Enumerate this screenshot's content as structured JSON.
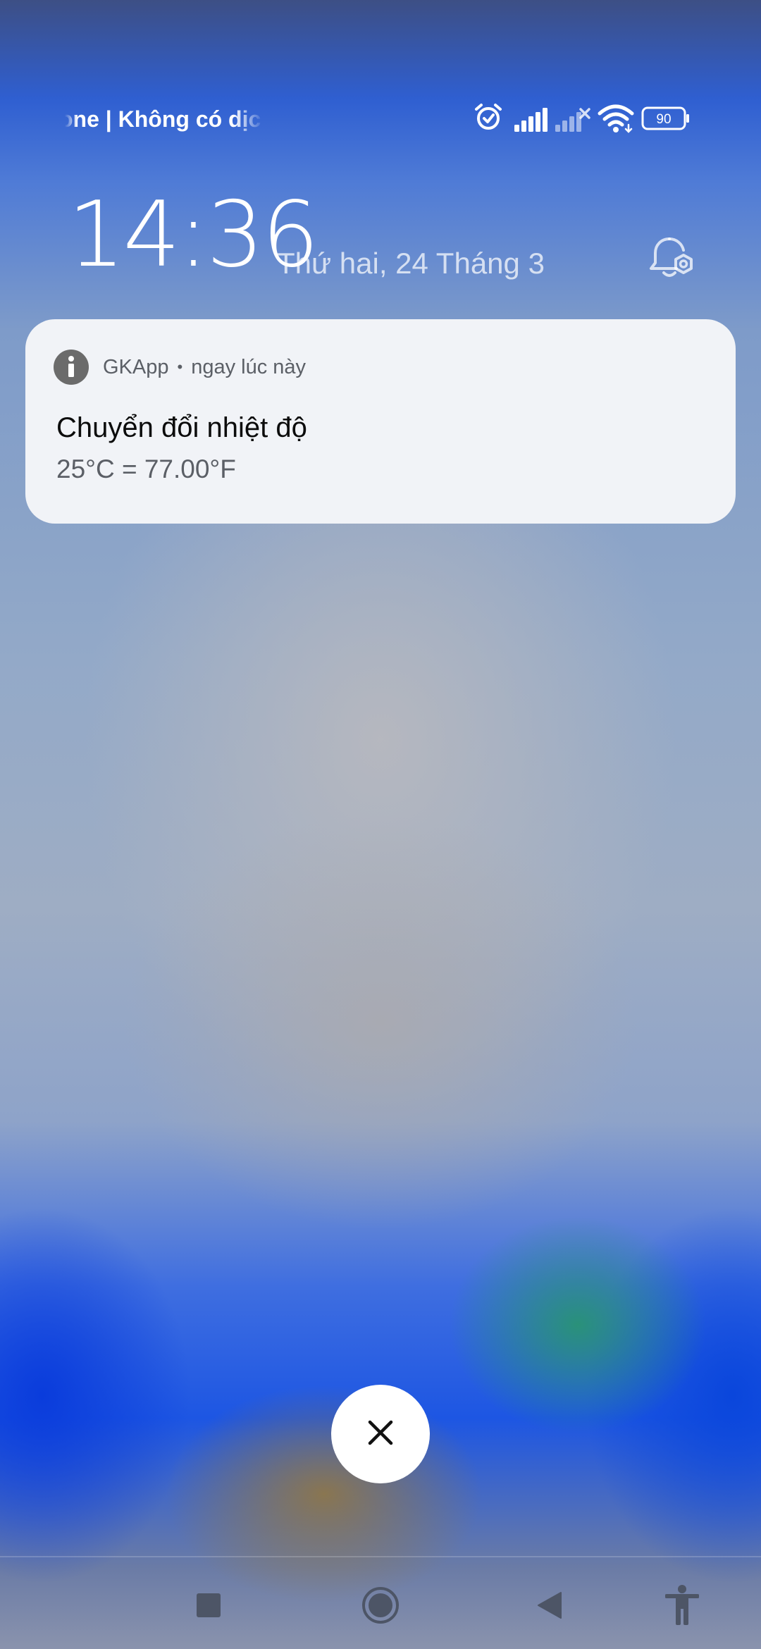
{
  "status_bar": {
    "carrier": "one | Không có dịc",
    "battery_level": "90",
    "icons": [
      "alarm-icon",
      "signal-icon",
      "no-signal-icon",
      "wifi-icon",
      "battery-icon"
    ]
  },
  "lockscreen": {
    "time": "14:36",
    "date": "Thứ hai, 24 Tháng 3"
  },
  "notification": {
    "app_name": "GKApp",
    "separator": "•",
    "time": "ngay lúc này",
    "title": "Chuyển đổi nhiệt độ",
    "body": "25°C = 77.00°F"
  },
  "nav_bar": {
    "buttons": [
      "recents-button",
      "home-button",
      "back-button",
      "accessibility-button"
    ]
  },
  "colors": {
    "notification_bg": "#f1f3f7",
    "app_icon_bg": "#6b6b6b",
    "nav_icon": "#4d5566"
  }
}
